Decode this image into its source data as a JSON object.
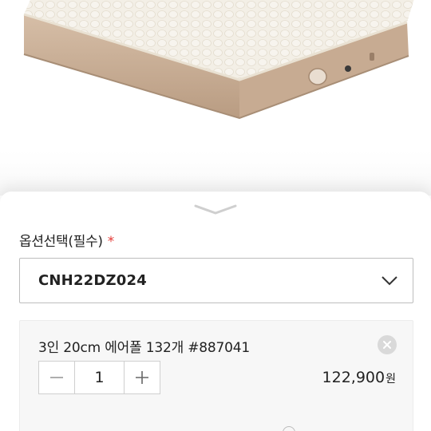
{
  "colors": {
    "accent": "#c62840",
    "required": "#e53935",
    "mattress_top": "#f3efe6",
    "mattress_side": "#c9ae95"
  },
  "option": {
    "title": "옵션선택(필수)",
    "required_mark": "*",
    "selected_value": "CNH22DZ024"
  },
  "item": {
    "name": "3인 20cm 에어폴 132개 #887041",
    "quantity": "1",
    "price": "122,900",
    "currency": "원"
  },
  "icons": {
    "sheet_handle": "chevron-down-icon",
    "select_chevron": "chevron-down-icon",
    "remove": "close-icon",
    "minus": "minus-icon",
    "plus": "plus-icon"
  }
}
